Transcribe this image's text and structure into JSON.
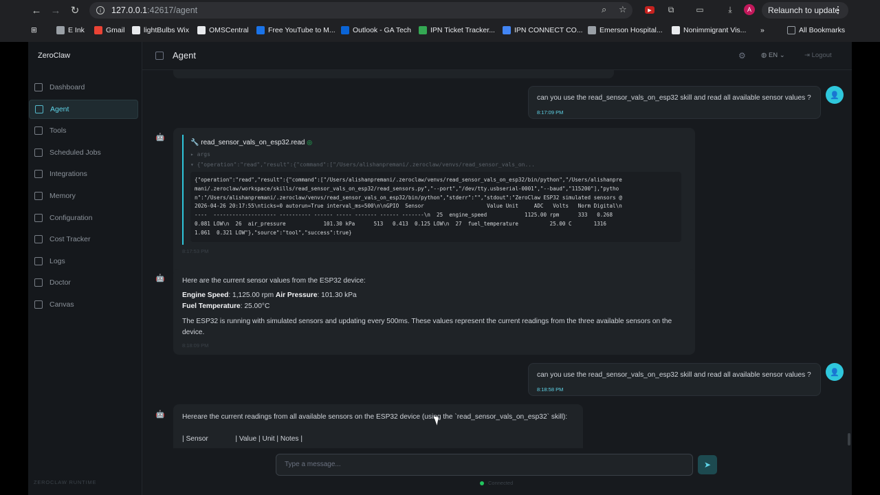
{
  "browser": {
    "url_host": "127.0.0.1",
    "url_rest": ":42617/agent",
    "relaunch_label": "Relaunch to update",
    "profile_initial": "A",
    "bookmarks": [
      {
        "label": "E Ink",
        "color": "#9aa0a6"
      },
      {
        "label": "Gmail",
        "color": "#ea4335"
      },
      {
        "label": "lightBulbs Wix",
        "color": "#e8eaed"
      },
      {
        "label": "OMSCentral",
        "color": "#e8eaed"
      },
      {
        "label": "Free YouTube to M...",
        "color": "#1a73e8"
      },
      {
        "label": "Outlook - GA Tech",
        "color": "#0a64d6"
      },
      {
        "label": "IPN Ticket Tracker...",
        "color": "#34a853"
      },
      {
        "label": "IPN CONNECT CO...",
        "color": "#4285f4"
      },
      {
        "label": "Emerson Hospital...",
        "color": "#9aa0a6"
      },
      {
        "label": "Nonimmigrant Vis...",
        "color": "#e8eaed"
      }
    ],
    "all_bookmarks": "All Bookmarks",
    "more": "»"
  },
  "app": {
    "brand": "ZeroClaw",
    "runtime": "ZEROCLAW RUNTIME",
    "nav": [
      {
        "label": "Dashboard",
        "active": false
      },
      {
        "label": "Agent",
        "active": true
      },
      {
        "label": "Tools",
        "active": false
      },
      {
        "label": "Scheduled Jobs",
        "active": false
      },
      {
        "label": "Integrations",
        "active": false
      },
      {
        "label": "Memory",
        "active": false
      },
      {
        "label": "Configuration",
        "active": false
      },
      {
        "label": "Cost Tracker",
        "active": false
      },
      {
        "label": "Logs",
        "active": false
      },
      {
        "label": "Doctor",
        "active": false
      },
      {
        "label": "Canvas",
        "active": false
      }
    ],
    "header": {
      "title": "Agent",
      "lang": "EN",
      "logout": "Logout"
    }
  },
  "chat": {
    "user_msg_1": {
      "text": "can you use the read_sensor_vals_on_esp32 skill and read all available sensor values ?",
      "time": "8:17:09 PM"
    },
    "tool": {
      "name": "read_sensor_vals_on_esp32.read",
      "args_label": "args",
      "summary": "{\"operation\":\"read\",\"result\":{\"command\":[\"/Users/alishanpremani/.zeroclaw/venvs/read_sensor_vals_on...",
      "output_lines": [
        "{\"operation\":\"read\",\"result\":{\"command\":[\"/Users/alishanpremani/.zeroclaw/venvs/read_sensor_vals_on_esp32/bin/python\",\"/Users/alishanpre",
        "mani/.zeroclaw/workspace/skills/read_sensor_vals_on_esp32/read_sensors.py\",\"--port\",\"/dev/tty.usbserial-0001\",\"--baud\",\"115200\"],\"pytho",
        "n\":\"/Users/alishanpremani/.zeroclaw/venvs/read_sensor_vals_on_esp32/bin/python\",\"stderr\":\"\",\"stdout\":\"ZeroClaw ESP32 simulated sensors @",
        "2026-04-26 20:17:55\\nticks=0 autorun=True interval_ms=500\\n\\nGPIO  Sensor                    Value Unit     ADC   Volts   Norm Digital\\n",
        "----  -------------------- ---------- ------ ----- ------- ------ -------\\n  25  engine_speed            1125.00 rpm      333   0.268",
        "0.081 LOW\\n  26  air_pressure            101.30 kPa      513   0.413  0.125 LOW\\n  27  fuel_temperature          25.00 C       1316",
        "1.061  0.321 LOW\"},\"source\":\"tool\",\"success\":true}"
      ],
      "time": "8:17:53 PM"
    },
    "bot_msg_1": {
      "intro": "Here are the current sensor values from the ESP32 device:",
      "k1": "Engine Speed",
      "v1": ": 1,125.00 rpm ",
      "k2": "Air Pressure",
      "v2": ": 101.30 kPa",
      "k3": "Fuel Temperature",
      "v3": ": 25.00°C",
      "para": "The ESP32 is running with simulated sensors and updating every 500ms. These values represent the current readings from the three available sensors on the device.",
      "time": "8:18:09 PM"
    },
    "user_msg_2": {
      "text": "can you use the read_sensor_vals_on_esp32 skill and read all available sensor values ?",
      "time": "8:18:58 PM"
    },
    "bot_msg_2": {
      "intro": "Hereare the current readings from all available sensors on the ESP32 device (using the `read_sensor_vals_on_esp32` skill):",
      "table_head": "| Sensor              | Value | Unit | Notes |"
    }
  },
  "composer": {
    "placeholder": "Type a message...",
    "status": "Connected"
  }
}
